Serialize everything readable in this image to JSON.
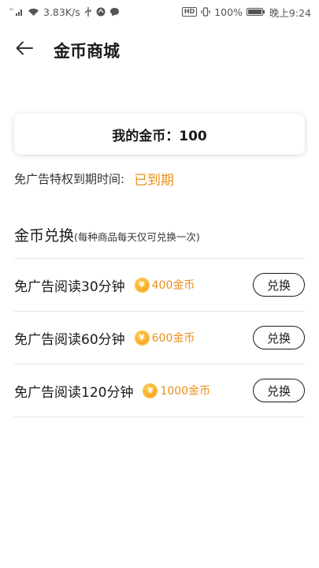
{
  "status_bar": {
    "signal_text": "⁴⁶",
    "speed": "3.83K/s",
    "hd": "HD",
    "battery": "100%",
    "time": "晚上9:24"
  },
  "header": {
    "title": "金币商城"
  },
  "coins": {
    "label": "我的金币：100"
  },
  "ad_free": {
    "label": "免广告特权到期时间:",
    "status": "已到期"
  },
  "exchange": {
    "title": "金币兑换",
    "note": "(每种商品每天仅可兑换一次)",
    "items": [
      {
        "label": "免广告阅读30分钟",
        "price": "400金币",
        "button": "兑换"
      },
      {
        "label": "免广告阅读60分钟",
        "price": "600金币",
        "button": "兑换"
      },
      {
        "label": "免广告阅读120分钟",
        "price": "1000金币",
        "button": "兑换"
      }
    ]
  },
  "colors": {
    "accent": "#e8901c",
    "coin": "#f6a924"
  },
  "icons": {
    "back": "arrow-left-icon",
    "coin": "coin-icon"
  }
}
